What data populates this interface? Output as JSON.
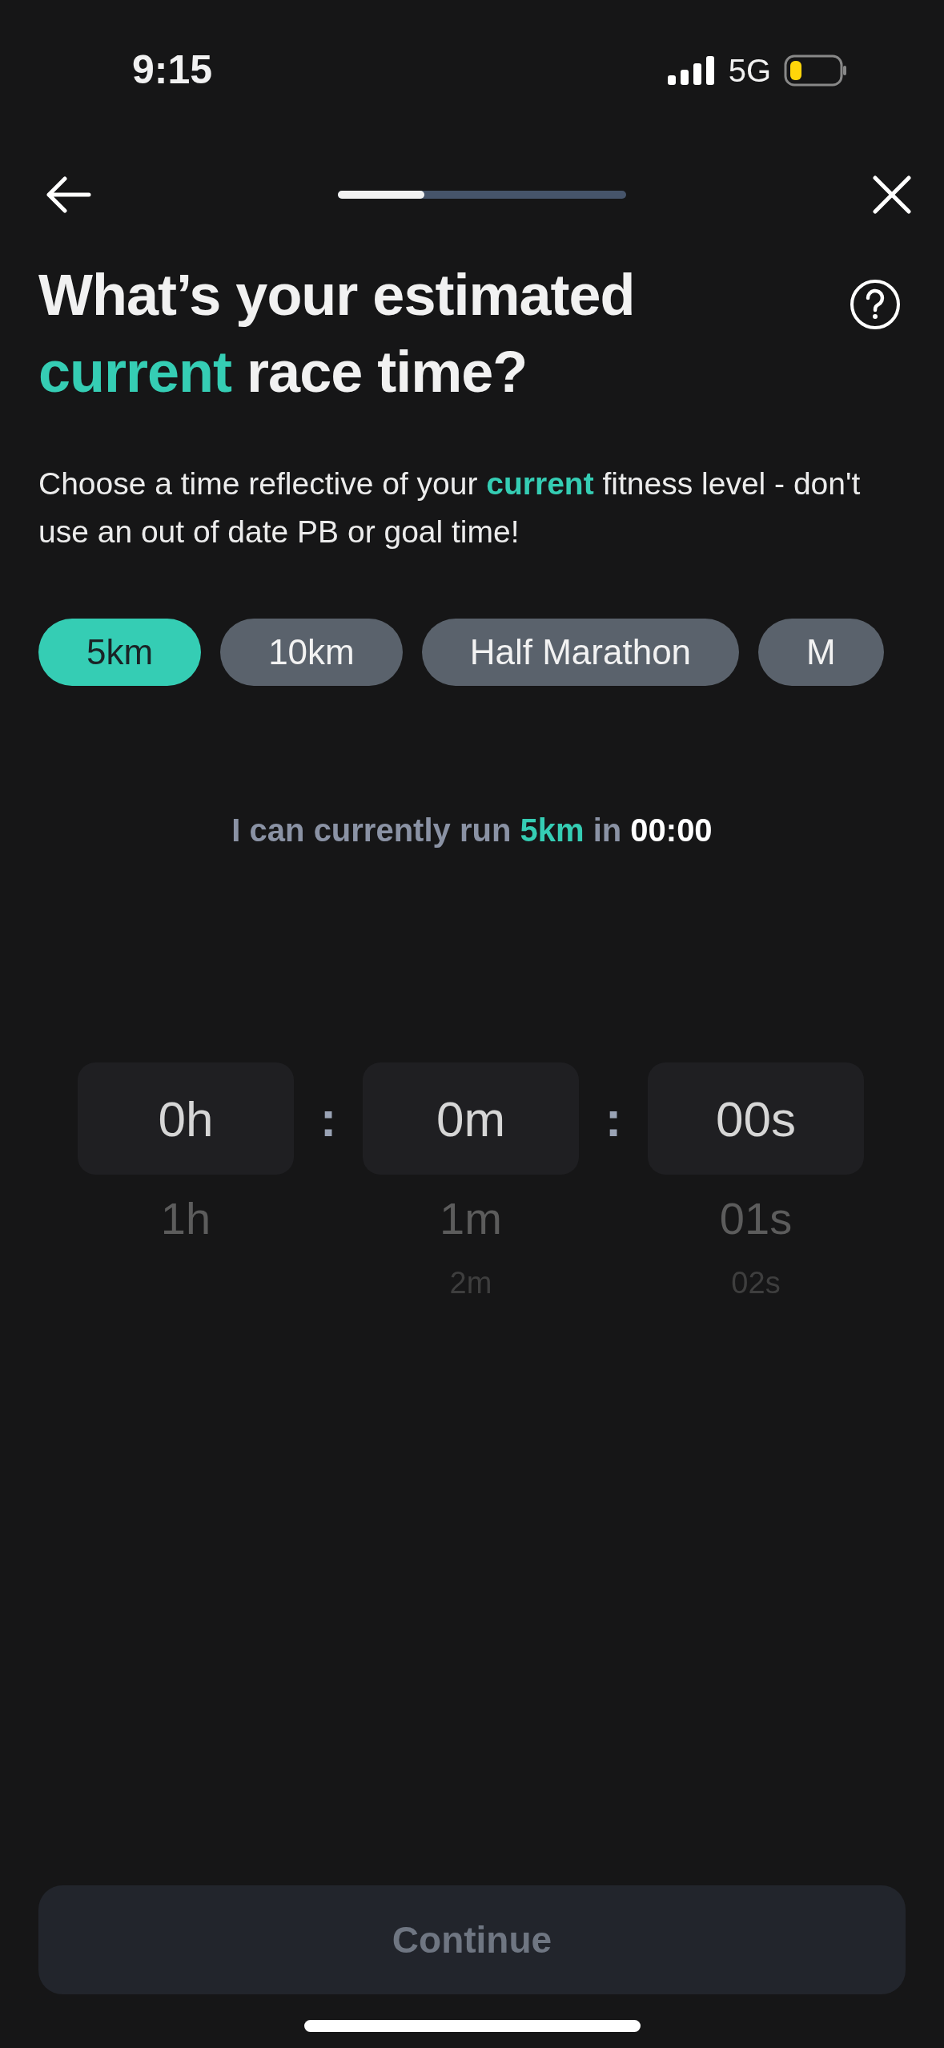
{
  "status_bar": {
    "time": "9:15",
    "network": "5G"
  },
  "header": {
    "progress": {
      "level": 0.3
    }
  },
  "title": "What’s your estimated **current** race time?",
  "subtitle": "Choose a time reflective of your **current** fitness level - don't use an out of date PB or goal time!",
  "distances": [
    {
      "label": "5km",
      "selected": true
    },
    {
      "label": "10km",
      "selected": false
    },
    {
      "label": "Half Marathon",
      "selected": false
    },
    {
      "label": "M",
      "selected": false
    }
  ],
  "summary": "I can currently run **5km** in *00:00*",
  "picker": {
    "columns": [
      {
        "items": [
          {
            "label": "0h",
            "selected": true
          },
          {
            "label": "1h",
            "selected": false
          }
        ]
      },
      {
        "items": [
          {
            "label": "0m",
            "selected": true
          },
          {
            "label": "1m",
            "selected": false
          },
          {
            "label": "2m",
            "selected": false
          }
        ]
      },
      {
        "items": [
          {
            "label": "00s",
            "selected": true
          },
          {
            "label": "01s",
            "selected": false
          },
          {
            "label": "02s",
            "selected": false
          }
        ]
      }
    ],
    "separators": [
      ":",
      ":"
    ]
  },
  "continue_button": {
    "label": "Continue",
    "disabled": true
  }
}
